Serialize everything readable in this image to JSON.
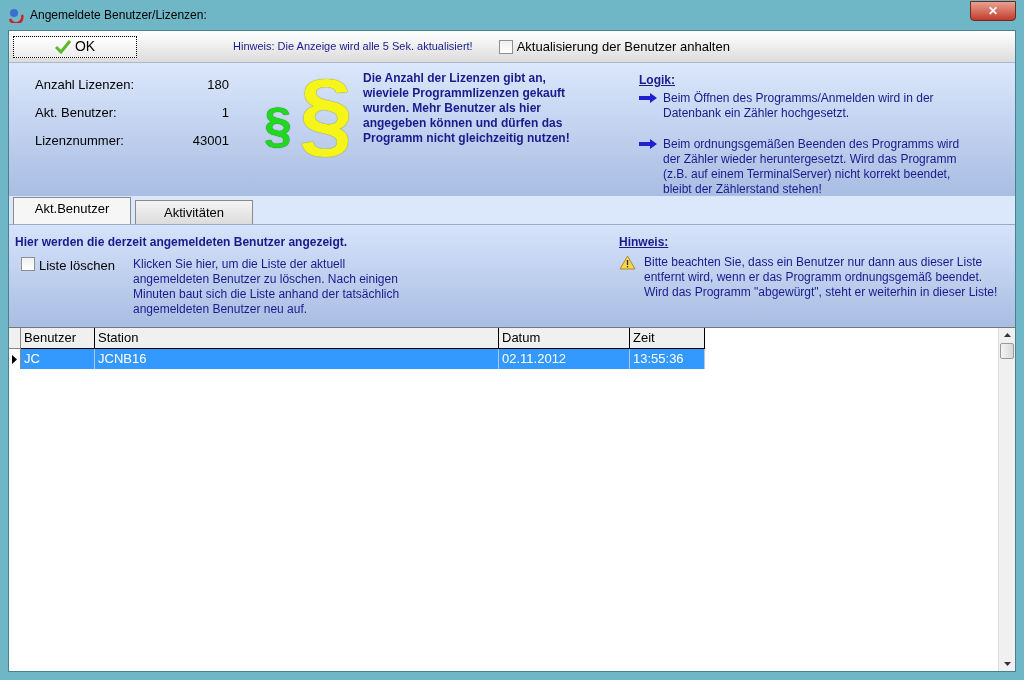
{
  "window": {
    "title": "Angemeldete Benutzer/Lizenzen:",
    "close": "✕"
  },
  "toolbar": {
    "ok_button": "OK",
    "hint": "Hinweis: Die Anzeige wird alle 5 Sek. aktualisiert!",
    "pause_checkbox": {
      "label": "Aktualisierung der Benutzer anhalten",
      "checked": false
    }
  },
  "license_info": {
    "fields": [
      {
        "label": "Anzahl Lizenzen:",
        "value": "180"
      },
      {
        "label": "Akt. Benutzer:",
        "value": "1"
      },
      {
        "label": "Lizenznummer:",
        "value": "43001"
      }
    ],
    "small_symbol": "§",
    "large_symbol": "§",
    "description": "Die Anzahl der Lizenzen gibt an, wieviele Programmlizenzen gekauft wurden. Mehr Benutzer als hier angegeben können und dürfen das Programm nicht gleichzeitig nutzen!",
    "logic_title": "Logik:",
    "logic_items": [
      "Beim Öffnen des Programms/Anmelden wird in der Datenbank ein Zähler hochgesetzt.",
      "Beim ordnungsgemäßen Beenden des Programms wird der Zähler wieder heruntergesetzt. Wird das Programm (z.B. auf einem TerminalServer) nicht korrekt beendet, bleibt der Zählerstand stehen!"
    ]
  },
  "tabs": [
    {
      "label": "Akt.Benutzer",
      "selected": true
    },
    {
      "label": "Aktivitäten",
      "selected": false
    }
  ],
  "tab_panel": {
    "heading": "Hier werden die derzeit angemeldeten Benutzer angezeigt.",
    "clear_checkbox": {
      "label": "Liste löschen",
      "checked": false
    },
    "clear_text": "Klicken Sie hier, um die Liste der aktuell angemeldeten Benutzer zu löschen.  Nach einigen Minuten baut sich die Liste anhand der tatsächlich angemeldeten Benutzer neu auf.",
    "note_title": "Hinweis:",
    "note_text": "Bitte beachten Sie, dass ein Benutzer nur dann aus dieser Liste entfernt wird, wenn er das Programm ordnungsgemäß beendet. Wird das Programm \"abgewürgt\", steht er weiterhin in dieser Liste!"
  },
  "table": {
    "columns": [
      "Benutzer",
      "Station",
      "Datum",
      "Zeit"
    ],
    "rows": [
      {
        "cells": [
          "JC",
          "JCNB16",
          "02.11.2012",
          "13:55:36"
        ],
        "selected": true
      }
    ]
  }
}
